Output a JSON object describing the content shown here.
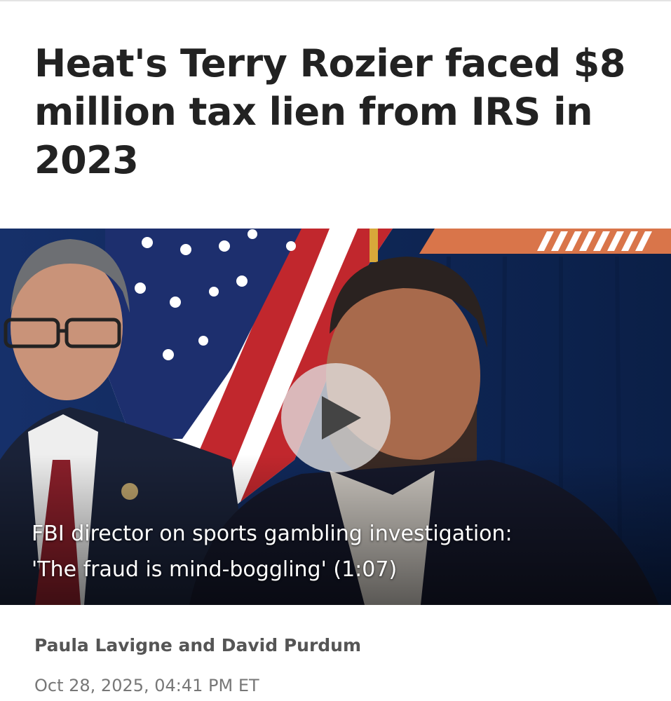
{
  "article": {
    "headline": "Heat's Terry Rozier faced $8 million tax lien from IRS in 2023",
    "byline": "Paula Lavigne and David Purdum",
    "timestamp": "Oct 28, 2025, 04:41 PM ET"
  },
  "video": {
    "caption_line1": "FBI director on sports gambling investigation:",
    "caption_line2": "'The fraud is mind-boggling' (1:07)",
    "play_icon": "play-icon",
    "accent_color": "#d9754a",
    "backdrop_color": "#0d2350"
  }
}
